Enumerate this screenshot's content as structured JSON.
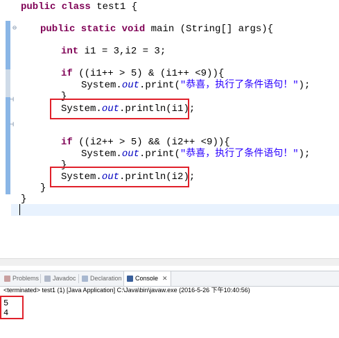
{
  "editor": {
    "lines": [
      {
        "kw": "public class ",
        "rest": "test1 {"
      },
      {
        "kw": "public static void ",
        "rest": "main (String[] args){"
      },
      {
        "kw": "int ",
        "rest": "i1 = 3,i2 = 3;"
      },
      {
        "kw": "if ",
        "rest": "((i1++ > 5) & (i1++ <9)){"
      },
      {
        "pre": "System.",
        "fld": "out",
        "mid": ".print(",
        "str": "\"恭喜，执行了条件语句！\"",
        "post": ");"
      },
      {
        "rest": "}"
      },
      {
        "pre": "System.",
        "fld": "out",
        "mid": ".println(i1);"
      },
      {
        "kw": "if ",
        "rest": "((i2++ > 5) && (i2++ <9)){"
      },
      {
        "pre": "System.",
        "fld": "out",
        "mid": ".print(",
        "str": "\"恭喜，执行了条件语句！\"",
        "post": ");"
      },
      {
        "rest": "}"
      },
      {
        "pre": "System.",
        "fld": "out",
        "mid": ".println(i2);"
      },
      {
        "rest": "}"
      },
      {
        "rest": "}"
      }
    ]
  },
  "tabs": [
    {
      "label": "Problems",
      "active": false
    },
    {
      "label": "Javadoc",
      "active": false
    },
    {
      "label": "Declaration",
      "active": false
    },
    {
      "label": "Console",
      "active": true
    }
  ],
  "console": {
    "status": "<terminated> test1 (1) [Java Application] C:\\Java\\bin\\javaw.exe (2016-5-26 下午10:40:56)",
    "output": [
      "5",
      "4"
    ]
  }
}
